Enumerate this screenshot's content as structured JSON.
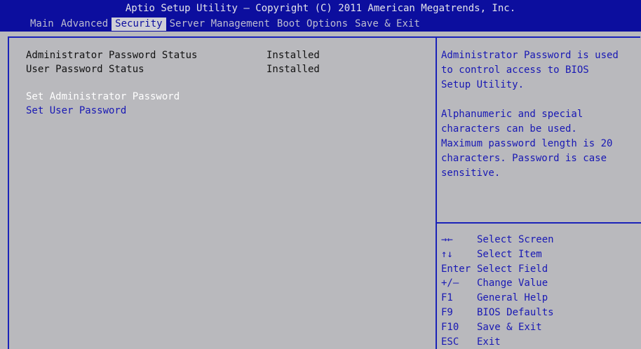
{
  "title": "Aptio Setup Utility – Copyright (C) 2011 American Megatrends, Inc.",
  "menu": [
    {
      "label": "Main"
    },
    {
      "label": "Advanced"
    },
    {
      "label": "Security"
    },
    {
      "label": "Server Management"
    },
    {
      "label": "Boot Options"
    },
    {
      "label": "Save & Exit"
    }
  ],
  "active_tab": "Security",
  "left": {
    "status": [
      {
        "label": "Administrator Password Status",
        "value": "Installed"
      },
      {
        "label": "User Password Status",
        "value": "Installed"
      }
    ],
    "links": [
      {
        "label": "Set Administrator Password"
      },
      {
        "label": "Set User Password"
      }
    ],
    "selected_link": "Set Administrator Password"
  },
  "help": {
    "paragraph1": [
      "Administrator Password is used",
      "to control access to BIOS",
      "Setup Utility."
    ],
    "paragraph2": [
      "Alphanumeric and special",
      "characters can be used.",
      "Maximum password length is 20",
      "characters. Password is case",
      "sensitive."
    ]
  },
  "keys": [
    {
      "key": "→←",
      "desc": "Select Screen"
    },
    {
      "key": "↑↓",
      "desc": "Select Item"
    },
    {
      "key": "Enter",
      "desc": "Select Field"
    },
    {
      "key": "+/–",
      "desc": "Change Value"
    },
    {
      "key": "F1",
      "desc": "General Help"
    },
    {
      "key": "F9",
      "desc": "BIOS Defaults"
    },
    {
      "key": "F10",
      "desc": "Save & Exit"
    },
    {
      "key": "ESC",
      "desc": "Exit"
    }
  ],
  "colors": {
    "header_bg": "#0c0e9e",
    "body_bg": "#b9b9bd",
    "accent_blue": "#1818b4",
    "selected_text": "#ffffff"
  }
}
